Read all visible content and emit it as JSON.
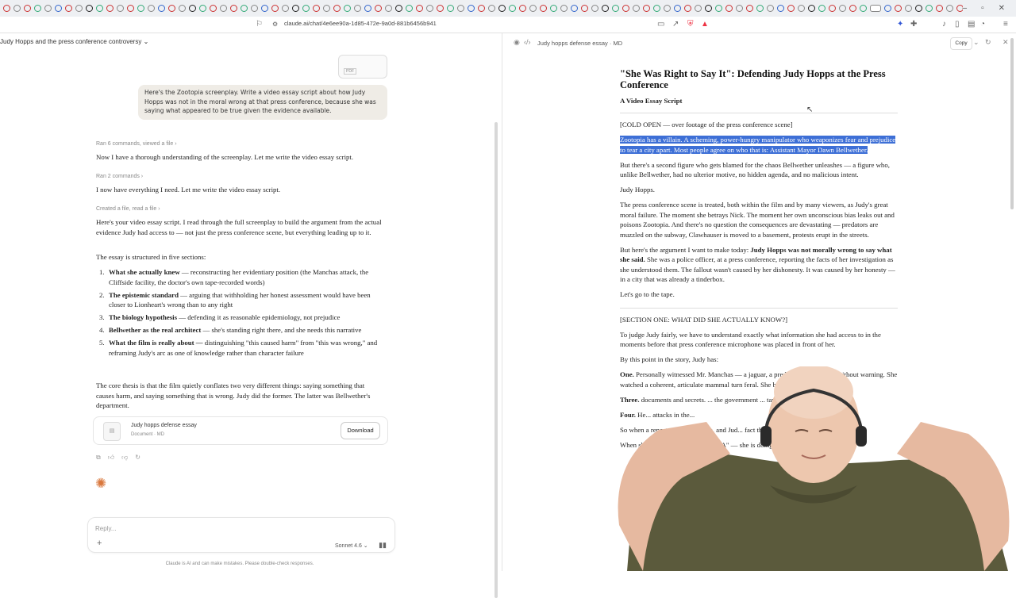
{
  "browser": {
    "url": "claude.ai/chat/4e6ee90a-1d85-472e-9a0d-881b6456b941"
  },
  "chat": {
    "title": "Judy Hopps and the press conference controversy",
    "attachment_label": "PDF",
    "user_message": "Here's the Zootopia screenplay. Write a video essay script about how Judy Hopps was not in the moral wrong at that press conference, because she was saying what appeared to be true given the evidence available.",
    "meta1": "Ran 6 commands, viewed a file ›",
    "line1": "Now I have a thorough understanding of the screenplay. Let me write the video essay script.",
    "meta2": "Ran 2 commands ›",
    "line2": "I now have everything I need. Let me write the video essay script.",
    "meta3": "Created a file, read a file ›",
    "para1": "Here's your video essay script. I read through the full screenplay to build the argument from the actual evidence Judy had access to — not just the press conference scene, but everything leading up to it.",
    "para2": "The essay is structured in five sections:",
    "sections": [
      {
        "num": "1.",
        "bold": "What she actually knew",
        "rest": " — reconstructing her evidentiary position (the Manchas attack, the Cliffside facility, the doctor's own tape-recorded words)"
      },
      {
        "num": "2.",
        "bold": "The epistemic standard",
        "rest": " — arguing that withholding her honest assessment would have been closer to Lionheart's wrong than to any right"
      },
      {
        "num": "3.",
        "bold": "The biology hypothesis",
        "rest": " — defending it as reasonable epidemiology, not prejudice"
      },
      {
        "num": "4.",
        "bold": "Bellwether as the real architect",
        "rest": " — she's standing right there, and she needs this narrative"
      },
      {
        "num": "5.",
        "bold": "What the film is really about —",
        "rest": " distinguishing \"this caused harm\" from \"this was wrong,\" and reframing Judy's arc as one of knowledge rather than character failure"
      }
    ],
    "para3": "The core thesis is that the film quietly conflates two very different things: saying something that causes harm, and saying something that is wrong. Judy did the former. The latter was Bellwether's department.",
    "doc_card": {
      "name": "Judy hopps defense essay",
      "type": "Document · MD",
      "download": "Download"
    },
    "reply_placeholder": "Reply...",
    "model": "Sonnet 4.6 ⌄",
    "disclaimer": "Claude is AI and can make mistakes. Please double-check responses."
  },
  "artifact": {
    "title": "Judy hopps defense essay · MD",
    "copy_label": "Copy",
    "heading": "\"She Was Right to Say It\": Defending Judy Hopps at the Press Conference",
    "subtitle": "A Video Essay Script",
    "cold_open": "[COLD OPEN — over footage of the press conference scene]",
    "highlighted": "Zootopia has a villain. A scheming, power-hungry manipulator who weaponizes fear and prejudice to tear a city apart. Most people agree on who that is: Assistant Mayor Dawn Bellwether.",
    "p2": "But there's a second figure who gets blamed for the chaos Bellwether unleashes — a figure who, unlike Bellwether, had no ulterior motive, no hidden agenda, and no malicious intent.",
    "p3": "Judy Hopps.",
    "p4": "The press conference scene is treated, both within the film and by many viewers, as Judy's great moral failure. The moment she betrays Nick. The moment her own unconscious bias leaks out and poisons Zootopia. And there's no question the consequences are devastating — predators are muzzled on the subway, Clawhauser is moved to a basement, protests erupt in the streets.",
    "p5_pre": "But here's the argument I want to make today: ",
    "p5_bold": "Judy Hopps was not morally wrong to say what she said.",
    "p5_post": " She was a police officer, at a press conference, reporting the facts of her investigation as she understood them. The fallout wasn't caused by her dishonesty. It was caused by her honesty — in a city that was already a tinderbox.",
    "p6": "Let's go to the tape.",
    "section1": "[SECTION ONE: WHAT DID SHE ACTUALLY KNOW?]",
    "p7": "To judge Judy fairly, we have to understand exactly what information she had access to in the moments before that press conference microphone was placed in front of her.",
    "p8": "By this point in the story, Judy has:",
    "p9_bold": "One.",
    "p9": " Personally witnessed Mr. Manchas — a jaguar, a predator — go savage without warning. She watched a coherent, articulate mammal turn feral. She barely escaped.",
    "p10_bold": "Three.",
    "p10": " documents and secrets. ... the government ... tape.",
    "p11_bold": "Four.",
    "p11": " He... attacks in the...",
    "p12": "So when a reporter asks... savage, and Jud... fact that is in her...",
    "p13": "When she follows up by ... their DNA\" — she is doing..."
  }
}
